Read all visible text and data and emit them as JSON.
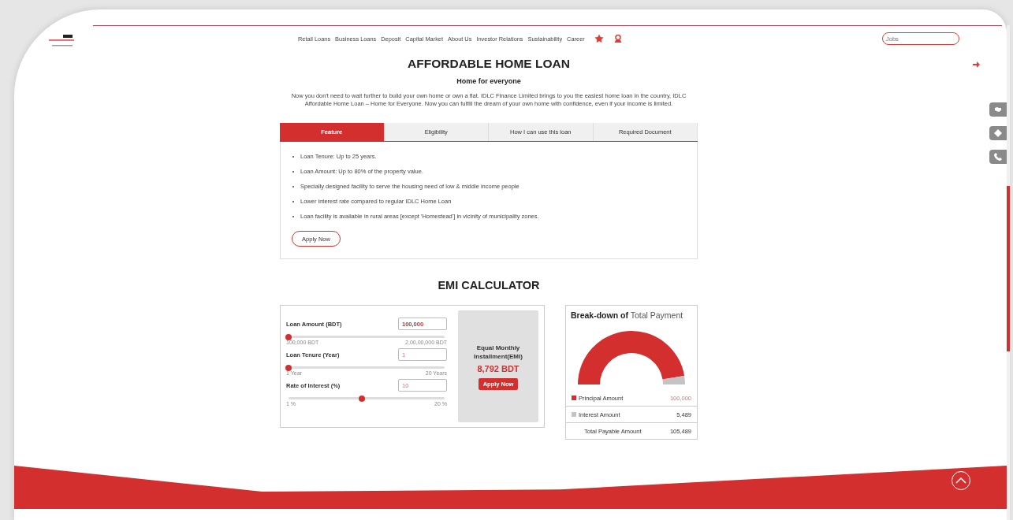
{
  "nav": {
    "items": [
      "Retail Loans",
      "Business Loans",
      "Deposit",
      "Capital Market",
      "About Us",
      "Investor Relations",
      "Sustainability",
      "Career"
    ],
    "search": {
      "placeholder": "Jobs"
    }
  },
  "hero": {
    "title": "AFFORDABLE HOME LOAN",
    "subtitle": "Home for everyone",
    "description": "Now you don't need to wait further to build your own home or own a flat. IDLC Finance Limited brings to you the easiest home loan in the country, IDLC Affordable Home Loan – Home for Everyone. Now you can fulfill the dream of your own home with confidence, even if your income is limited."
  },
  "tabs": [
    {
      "label": "Feature",
      "selected": true
    },
    {
      "label": "Eligibility",
      "selected": false
    },
    {
      "label": "How I can use this loan",
      "selected": false
    },
    {
      "label": "Required Document",
      "selected": false
    }
  ],
  "features": [
    "Loan Tenure: Up to 25 years.",
    "Loan Amount: Up to 80% of the property value.",
    "Specially designed facility to serve the housing need of low & middle income people",
    "Lower interest rate compared to regular IDLC Home Loan",
    "Loan facility is available in rural areas [except 'Homestead'] in vicinity of municipality zones."
  ],
  "apply_button": "Apply Now",
  "calculator": {
    "title": "EMI CALCULATOR",
    "inputs": [
      {
        "label": "Loan Amount (BDT)",
        "value": "100,000",
        "level": 0,
        "min": "100,000 BDT",
        "max": "2,00,00,000 BDT"
      },
      {
        "label": "Loan Tenure (Year)",
        "value": "1",
        "level": 0,
        "min": "1 Year",
        "max": "20 Years"
      },
      {
        "label": "Rate of Interest (%)",
        "value": "10",
        "level": 0.47,
        "min": "1 %",
        "max": "20 %"
      }
    ],
    "result": {
      "label": "Equal Monthly Installment(EMI)",
      "amount": "8,792 BDT",
      "button": "Apply Now"
    }
  },
  "breakdown": {
    "title_bold": "Break-down of",
    "title_rest": "Total Payment",
    "chart_data": {
      "type": "donut",
      "categories": [
        "Principal Amount",
        "Interest Amount"
      ],
      "values": [
        94.8,
        5.2
      ]
    },
    "legend": [
      {
        "value": "100,000",
        "color": "#d32f2f"
      },
      {
        "value": "5,489",
        "color": "#c4c4c4"
      }
    ],
    "total": {
      "label": "Total Payable Amount",
      "value": "105,489"
    }
  }
}
